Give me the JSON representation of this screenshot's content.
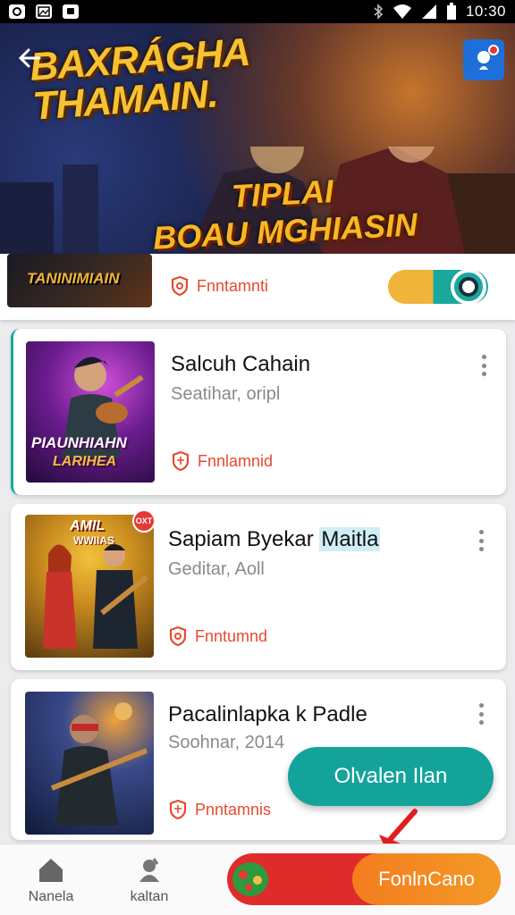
{
  "status_bar": {
    "time": "10:30",
    "icons": [
      "app-icon-c",
      "gallery-icon",
      "message-icon",
      "bluetooth-icon",
      "wifi-icon",
      "signal-icon",
      "battery-icon"
    ]
  },
  "hero": {
    "title_line1": "BAXRÁGHA",
    "title_line2": "THAMAIN.",
    "subtitle_line1": "TIPLAI",
    "subtitle_line2": "BOAU MGHIASIN",
    "back_icon": "arrow-left-icon",
    "notify_icon": "notification-icon"
  },
  "list": {
    "partial_card": {
      "thumb_text": "TANINIMIAIN",
      "badge": "Fnntamnti"
    },
    "cards": [
      {
        "title": "Salcuh Cahain",
        "subtitle": "Seatihar, oripl",
        "badge": "Fnnlamnid",
        "thumb_text1": "PIAUNHIAHN",
        "thumb_text2": "LARIHEA"
      },
      {
        "title_prefix": "Sapiam Byekar",
        "title_highlight": "Maitla",
        "subtitle": "Geditar, Aoll",
        "badge": "Fnntumnd",
        "thumb_text1": "AMIL",
        "thumb_text2": "WWIIAS",
        "thumb_badge": "OXT"
      },
      {
        "title": "Pacalinlapka k Padle",
        "subtitle": "Soohnar, 2014",
        "badge": "Pnntamnis"
      }
    ],
    "fab_label": "Olvalen Ilan"
  },
  "bottom_nav": {
    "items": [
      {
        "label": "Nanela",
        "icon": "home-icon"
      },
      {
        "label": "kaltan",
        "icon": "character-icon"
      }
    ],
    "promo_label": "FonlnCano"
  },
  "colors": {
    "accent_teal": "#14a39b",
    "badge_red": "#e64a2e",
    "promo_orange": "#f57c1f",
    "promo_red": "#e02b2b"
  }
}
